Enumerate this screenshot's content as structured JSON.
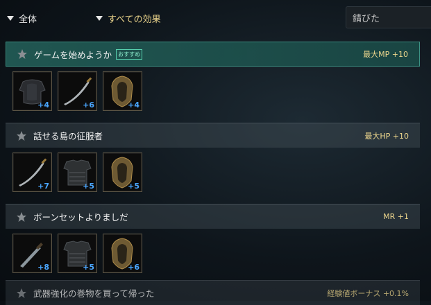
{
  "filters": {
    "category": "全体",
    "effect": "すべての効果",
    "search_value": "錆びた"
  },
  "sets": [
    {
      "title": "ゲームを始めようか",
      "badge": "おすすめ",
      "bonus": "最大MP +10",
      "items": [
        {
          "icon": "armor-icon",
          "enhance": "+4"
        },
        {
          "icon": "sword-icon",
          "enhance": "+6"
        },
        {
          "icon": "shield-icon",
          "enhance": "+4"
        }
      ]
    },
    {
      "title": "話せる島の征服者",
      "bonus": "最大HP +10",
      "items": [
        {
          "icon": "sword-icon",
          "enhance": "+7"
        },
        {
          "icon": "armor-icon",
          "enhance": "+5"
        },
        {
          "icon": "shield-icon",
          "enhance": "+5"
        }
      ]
    },
    {
      "title": "ボーンセットよりましだ",
      "bonus": "MR +1",
      "items": [
        {
          "icon": "dagger-icon",
          "enhance": "+8"
        },
        {
          "icon": "armor-icon",
          "enhance": "+5"
        },
        {
          "icon": "shield-icon",
          "enhance": "+6"
        }
      ]
    },
    {
      "title": "武器強化の巻物を買って帰った",
      "bonus": "経験値ボーナス +0.1%"
    }
  ],
  "colors": {
    "accent_text": "#efd88e",
    "enhance_text": "#4aa6ff",
    "active_header": "#225c56"
  }
}
